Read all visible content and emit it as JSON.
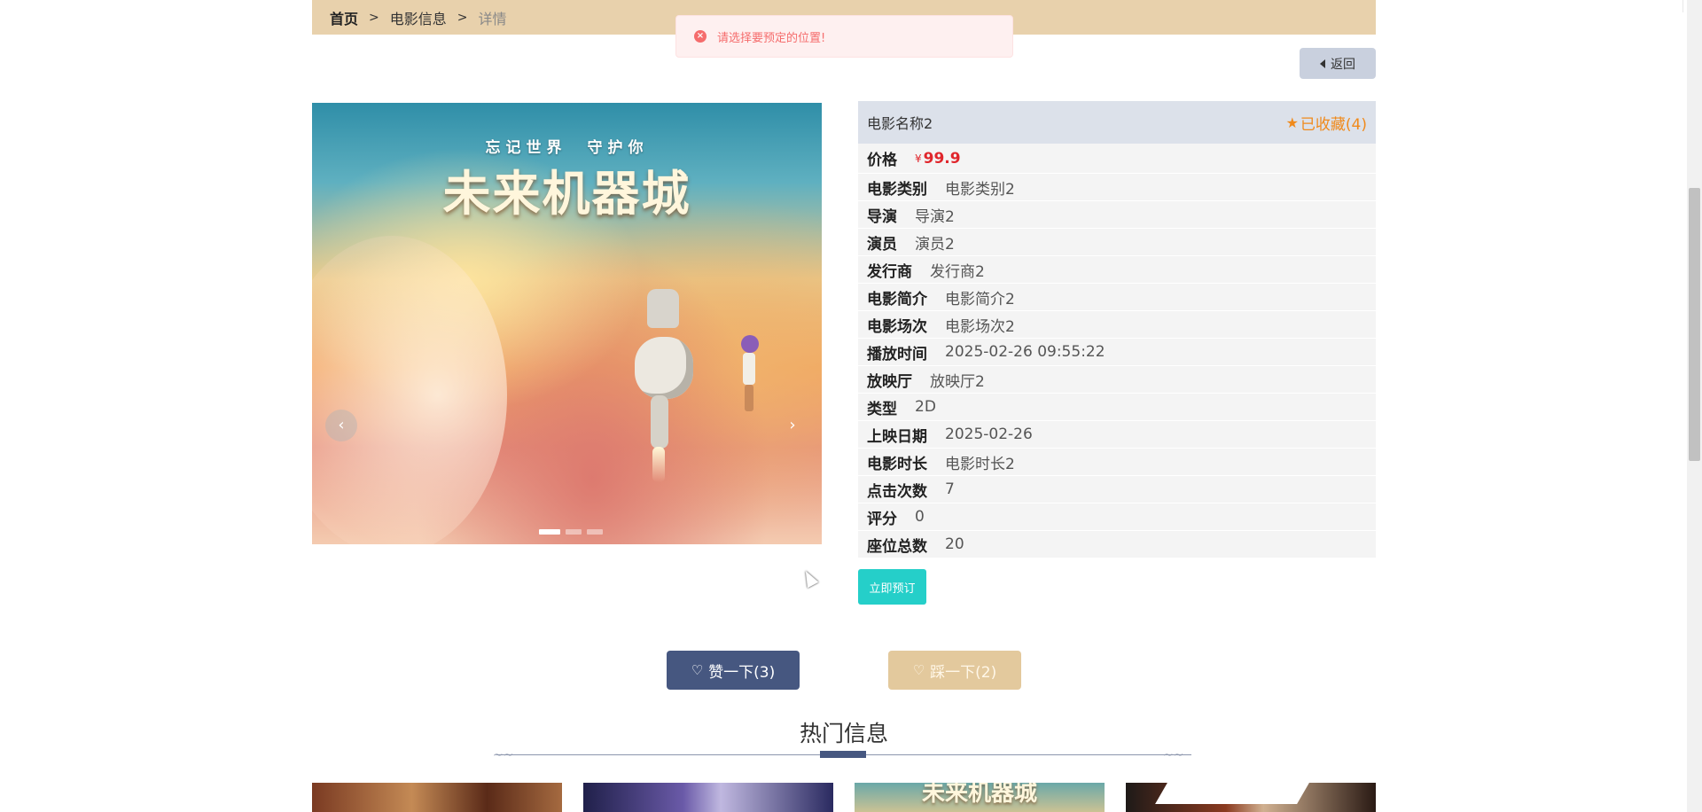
{
  "breadcrumb": {
    "home": "首页",
    "sep": ">",
    "section": "电影信息",
    "current": "详情"
  },
  "toast": {
    "message": "请选择要预定的位置!",
    "icon": "error-circle-icon",
    "color": "#f56c6c"
  },
  "back_button": {
    "label": "返回",
    "icon": "caret-left-icon"
  },
  "carousel": {
    "poster_subtitle": "忘记世界　守护你",
    "poster_title": "未来机器城",
    "prev_label": "‹",
    "next_label": "›",
    "slide_count": 3,
    "active_slide": 1
  },
  "detail": {
    "name": "电影名称2",
    "favorite_label": "已收藏(4)",
    "favorite_icon": "star-icon",
    "price_label": "价格",
    "currency": "¥",
    "price": "99.9",
    "fields": [
      {
        "label": "电影类别",
        "value": "电影类别2"
      },
      {
        "label": "导演",
        "value": "导演2"
      },
      {
        "label": "演员",
        "value": "演员2"
      },
      {
        "label": "发行商",
        "value": "发行商2"
      },
      {
        "label": "电影简介",
        "value": "电影简介2"
      },
      {
        "label": "电影场次",
        "value": "电影场次2"
      },
      {
        "label": "播放时间",
        "value": "2025-02-26 09:55:22"
      },
      {
        "label": "放映厅",
        "value": "放映厅2"
      },
      {
        "label": "类型",
        "value": "2D"
      },
      {
        "label": "上映日期",
        "value": "2025-02-26"
      },
      {
        "label": "电影时长",
        "value": "电影时长2"
      },
      {
        "label": "点击次数",
        "value": "7"
      },
      {
        "label": "评分",
        "value": "0"
      },
      {
        "label": "座位总数",
        "value": "20"
      }
    ]
  },
  "book_button": {
    "label": "立即预订"
  },
  "votes": {
    "like_label": "赞一下(3)",
    "dislike_label": "踩一下(2)",
    "like_icon": "thumbs-up-icon",
    "dislike_icon": "thumbs-down-icon"
  },
  "hot": {
    "title": "热门信息",
    "thumb3_title": "未来机器城"
  },
  "colors": {
    "breadcrumb_bg": "#e8d1ac",
    "accent_navy": "#465780",
    "price_red": "#e0262c",
    "favorite_orange": "#f08a1c",
    "book_teal": "#25cfc9",
    "dislike_tan": "#e3c99d"
  }
}
